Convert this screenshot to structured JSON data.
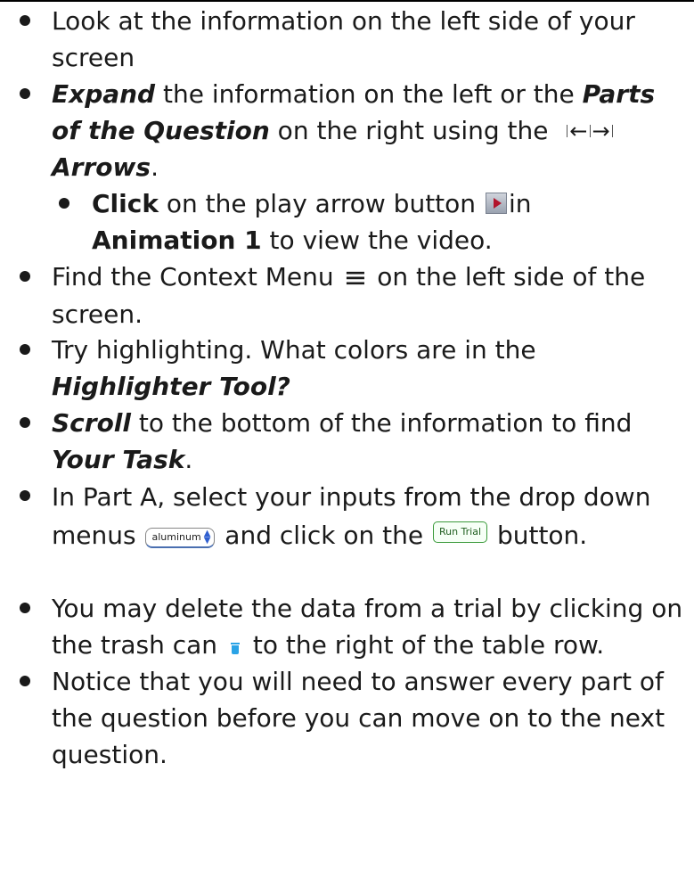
{
  "items": [
    {
      "text": "Look at the information on the left side of your screen"
    },
    {
      "t1": "Expand",
      "t2": " the information on the left or the ",
      "t3": "Parts of the Question",
      "t4": " on the right using the ",
      "t5": "Arrows",
      "t6": "."
    },
    {
      "t1": "Click",
      "t2": " on the play arrow button ",
      "t3": "in ",
      "t4": "Animation 1",
      "t5": " to view the video."
    },
    {
      "t1": "Find the Context Menu ",
      "icon": "≡",
      "t2": " on the left side of the screen."
    },
    {
      "t1": "Try highlighting. What colors are in the ",
      "t2": "Highlighter Tool?"
    },
    {
      "t1": "Scroll",
      "t2": " to the bottom of the information to find ",
      "t3": "Your Task",
      "t4": "."
    },
    {
      "t1": "In Part A, select your inputs from the drop down menus ",
      "select_label": "aluminum",
      "t2": " and click on the ",
      "button_label": "Run Trial",
      "t3": " button."
    },
    {
      "t1": "You may delete the data from a trial by clicking on the trash can ",
      "t2": " to the right of the table row."
    },
    {
      "text": "Notice that you will need to answer every part of the question before you can move on to the next question."
    }
  ],
  "icons": {
    "arrows": "expand-collapse-arrows-icon",
    "play": "play-button-icon",
    "menu": "context-menu-icon",
    "select": "dropdown-select-icon",
    "run": "run-trial-button-icon",
    "trash": "trash-can-icon"
  },
  "colors": {
    "text": "#1a1a1a",
    "trash": "#2aa3e6",
    "run_button_border": "#3a9a3a",
    "play_triangle": "#b2142b"
  }
}
